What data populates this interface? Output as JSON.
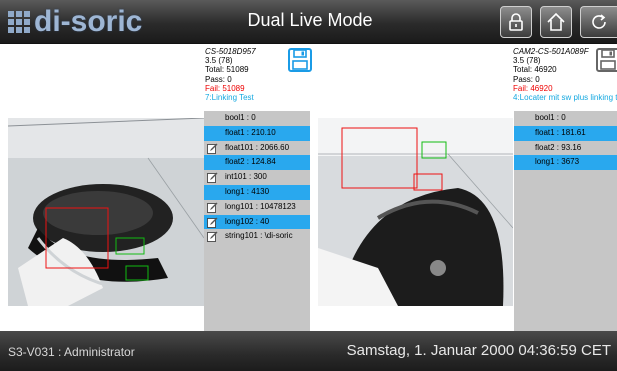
{
  "header": {
    "logo_text": "di-soric",
    "title": "Dual Live Mode",
    "buttons": [
      {
        "icon": "lock-icon"
      },
      {
        "icon": "home-icon"
      },
      {
        "icon": "refresh-icon"
      }
    ]
  },
  "left": {
    "camera": "CS-5018D957",
    "version": "3.5 (78)",
    "total": "Total: 51089",
    "pass": "Pass: 0",
    "fail": "Fail: 51089",
    "job": "7:Linking Test",
    "save_icon": "save-icon",
    "results": [
      {
        "label": "bool1 : 0",
        "editable": false,
        "selected": false
      },
      {
        "label": "float1 : 210.10",
        "editable": false,
        "selected": true
      },
      {
        "label": "float101 : 2066.60",
        "editable": true,
        "selected": false
      },
      {
        "label": "float2 : 124.84",
        "editable": false,
        "selected": true
      },
      {
        "label": "int101 : 300",
        "editable": true,
        "selected": false
      },
      {
        "label": "long1 : 4130",
        "editable": false,
        "selected": true
      },
      {
        "label": "long101 : 10478123",
        "editable": true,
        "selected": false
      },
      {
        "label": "long102 : 40",
        "editable": true,
        "selected": true
      },
      {
        "label": "string101 : \\di-soric",
        "editable": true,
        "selected": false
      }
    ]
  },
  "right": {
    "camera": "CAM2-CS-501A089F",
    "version": "3.5 (78)",
    "total": "Total: 46920",
    "pass": "Pass: 0",
    "fail": "Fail: 46920",
    "job": "4:Locater mit sw plus linking t",
    "save_icon": "save-icon",
    "results": [
      {
        "label": "bool1 : 0",
        "editable": false,
        "selected": false
      },
      {
        "label": "float1 : 181.61",
        "editable": false,
        "selected": true
      },
      {
        "label": "float2 : 93.16",
        "editable": false,
        "selected": false
      },
      {
        "label": "long1 : 3673",
        "editable": false,
        "selected": true
      }
    ]
  },
  "status": {
    "user": "S3-V031 : Administrator",
    "datetime": "Samstag, 1. Januar 2000 04:36:59 CET"
  },
  "colors": {
    "selected_row": "#29a8ee",
    "fail_text": "#ee0000",
    "job_text": "#14a8e0",
    "logo": "#9eb6d4"
  }
}
